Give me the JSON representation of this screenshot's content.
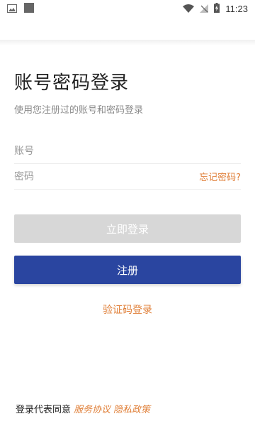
{
  "status_bar": {
    "time": "11:23",
    "left_icons": [
      "image-icon",
      "square-icon"
    ],
    "right_icons": [
      "wifi-icon",
      "no-signal-icon",
      "battery-charging-icon"
    ]
  },
  "login": {
    "title": "账号密码登录",
    "subtitle": "使用您注册过的账号和密码登录",
    "account_placeholder": "账号",
    "password_placeholder": "密码",
    "forgot_password": "忘记密码?",
    "login_button": "立即登录",
    "register_button": "注册",
    "sms_login": "验证码登录"
  },
  "agreement": {
    "prefix": "登录代表同意",
    "service_agreement": "服务协议",
    "privacy_policy": "隐私政策"
  },
  "colors": {
    "accent_orange": "#e0803a",
    "primary_blue": "#2a45a0",
    "disabled_gray": "#d7d7d7"
  }
}
